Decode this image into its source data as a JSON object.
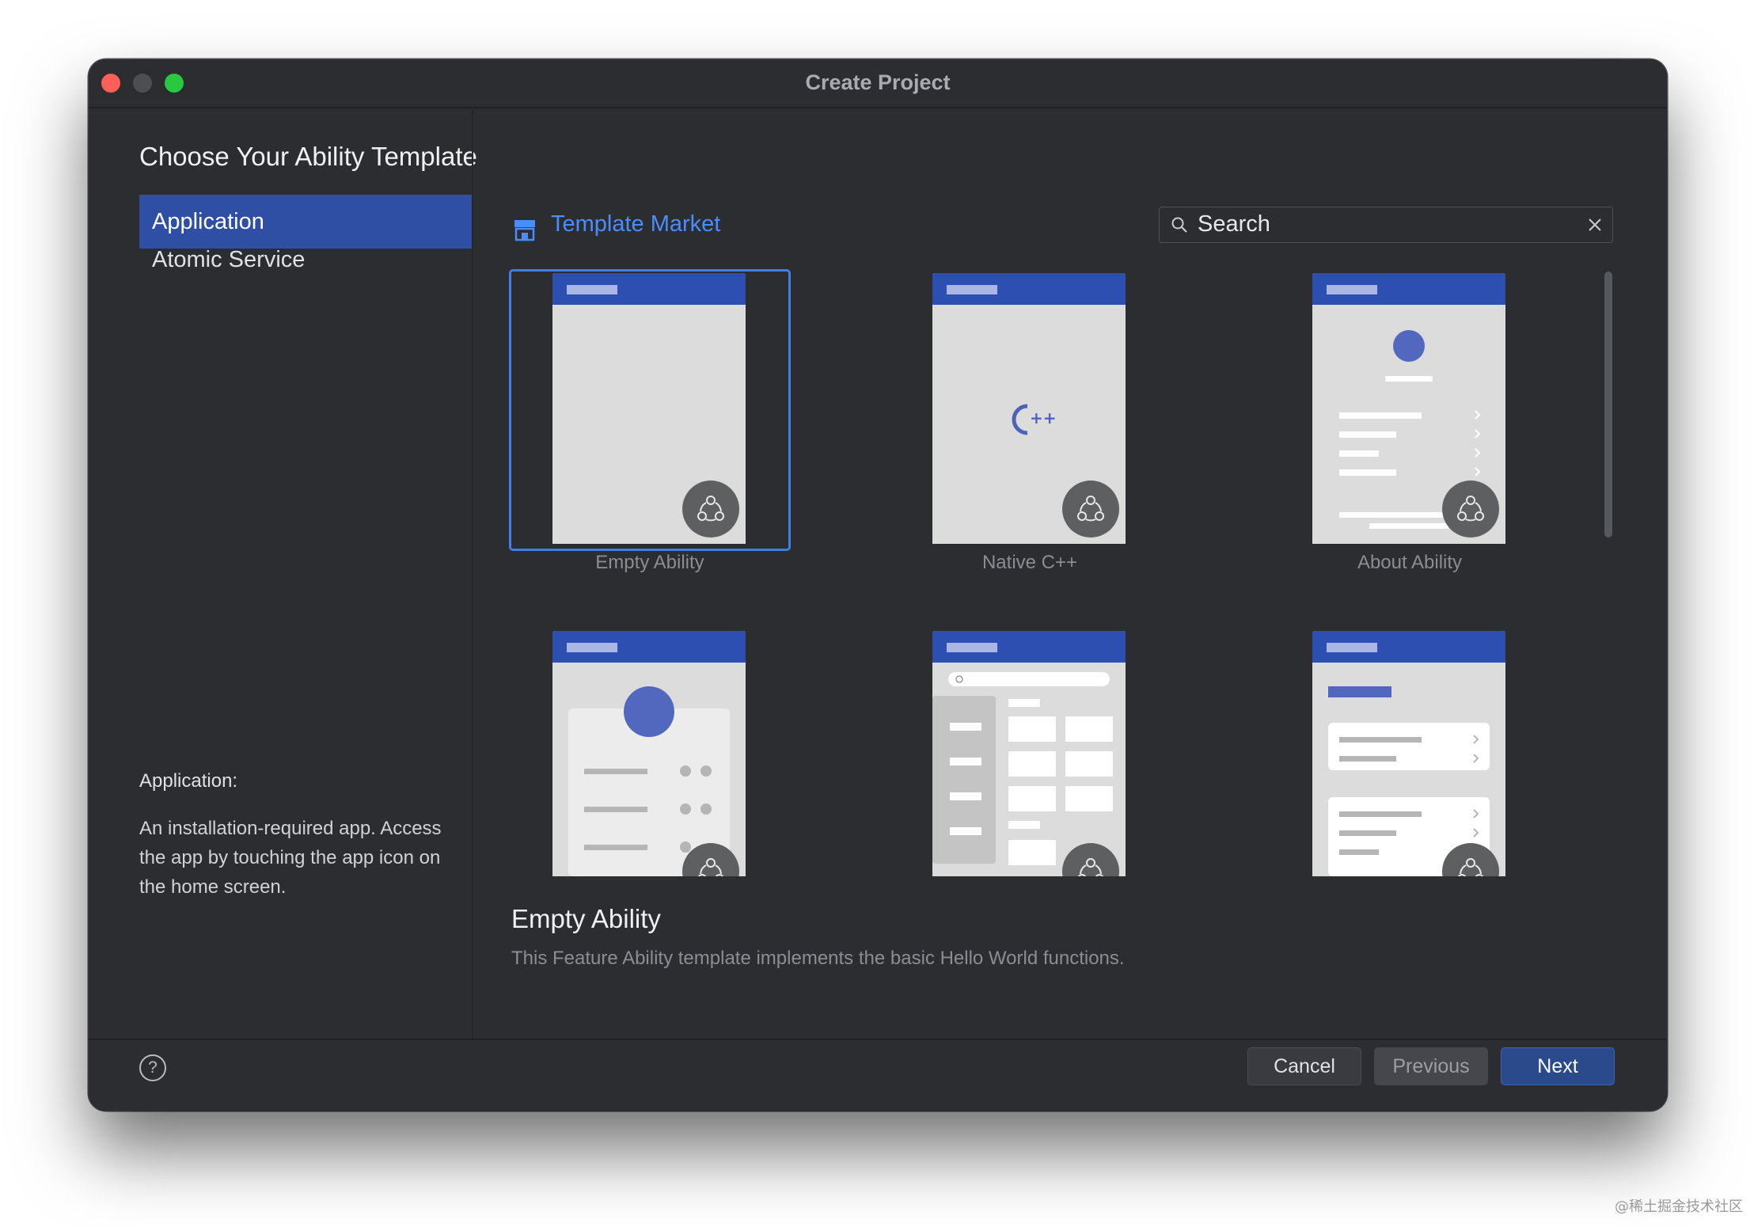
{
  "window": {
    "title": "Create Project"
  },
  "page": {
    "title": "Choose Your Ability Template"
  },
  "sidebar": {
    "items": [
      {
        "label": "Application",
        "selected": true
      },
      {
        "label": "Atomic Service",
        "selected": false
      }
    ],
    "description_title": "Application:",
    "description": "An installation-required app. Access the app by touching the app icon on the home screen."
  },
  "market": {
    "label": "Template Market"
  },
  "search": {
    "value": "",
    "placeholder": "Search"
  },
  "templates": [
    {
      "label": "Empty Ability",
      "selected": true
    },
    {
      "label": "Native C++",
      "selected": false
    },
    {
      "label": "About Ability",
      "selected": false
    },
    {
      "label": "",
      "selected": false
    },
    {
      "label": "",
      "selected": false
    },
    {
      "label": "",
      "selected": false
    }
  ],
  "detail": {
    "title": "Empty Ability",
    "description": "This Feature Ability template implements the basic Hello World functions."
  },
  "footer": {
    "help_glyph": "?",
    "cancel_label": "Cancel",
    "previous_label": "Previous",
    "next_label": "Next"
  },
  "watermark": "@稀土掘金技术社区",
  "colors": {
    "accent": "#2e4fa3",
    "link": "#4b8dfa",
    "selection_border": "#3f7fe6",
    "template_header": "#2e4fb2",
    "window_bg": "#2b2d30"
  }
}
